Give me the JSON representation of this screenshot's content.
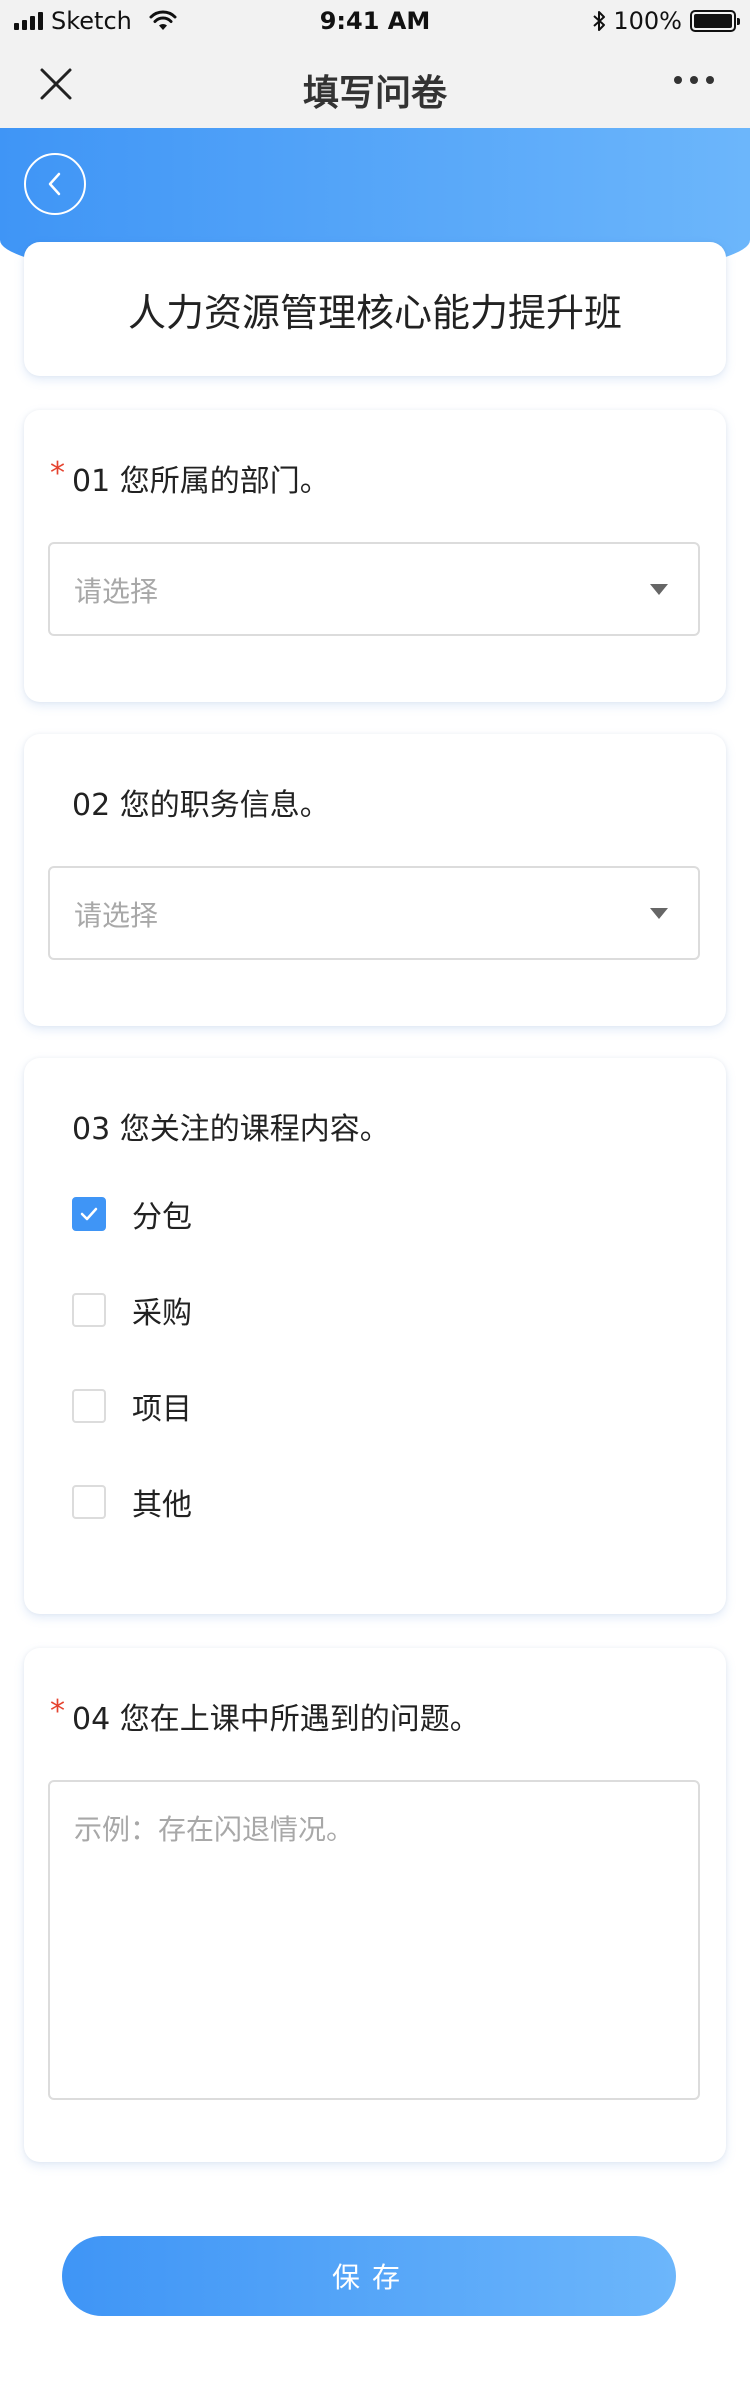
{
  "status_bar": {
    "carrier": "Sketch",
    "time": "9:41 AM",
    "battery": "100%"
  },
  "nav": {
    "title": "填写问卷",
    "close_icon": "close-icon",
    "more_icon": "more-icon"
  },
  "header": {
    "back_icon": "chevron-left-icon",
    "course_title": "人力资源管理核心能力提升班"
  },
  "questions": [
    {
      "required": true,
      "required_mark": "*",
      "title": "01 您所属的部门。",
      "type": "select",
      "placeholder": "请选择"
    },
    {
      "required": false,
      "title": "02 您的职务信息。",
      "type": "select",
      "placeholder": "请选择"
    },
    {
      "required": false,
      "title": "03 您关注的课程内容。",
      "type": "checkbox",
      "options": [
        {
          "label": "分包",
          "checked": true
        },
        {
          "label": "采购",
          "checked": false
        },
        {
          "label": "项目",
          "checked": false
        },
        {
          "label": "其他",
          "checked": false
        }
      ]
    },
    {
      "required": true,
      "required_mark": "*",
      "title": "04 您在上课中所遇到的问题。",
      "type": "textarea",
      "placeholder": "示例：存在闪退情况。"
    }
  ],
  "save_button": {
    "label": "保存"
  },
  "colors": {
    "accent": "#3f95f6",
    "accent_light": "#6cb6fb",
    "required": "#e5432f"
  }
}
